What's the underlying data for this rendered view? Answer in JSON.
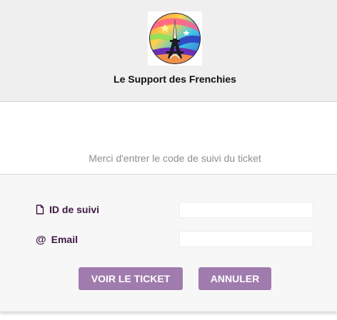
{
  "header": {
    "logo_icon": "eiffel-tower-logo",
    "title": "Le Support des Frenchies"
  },
  "main": {
    "instruction": "Merci d'entrer le code de suivi du ticket"
  },
  "form": {
    "tracking_id": {
      "icon": "document-icon",
      "label": "ID de suivi",
      "value": "",
      "placeholder": ""
    },
    "email": {
      "icon": "at-icon",
      "icon_glyph": "@",
      "label": "Email",
      "value": "",
      "placeholder": ""
    },
    "view_button_label": "VOIR LE TICKET",
    "cancel_button_label": "ANNULER"
  },
  "colors": {
    "header_background": "#efefef",
    "label_color": "#3e1743",
    "button_background": "#a07bae",
    "form_background": "#f7f7f7"
  }
}
